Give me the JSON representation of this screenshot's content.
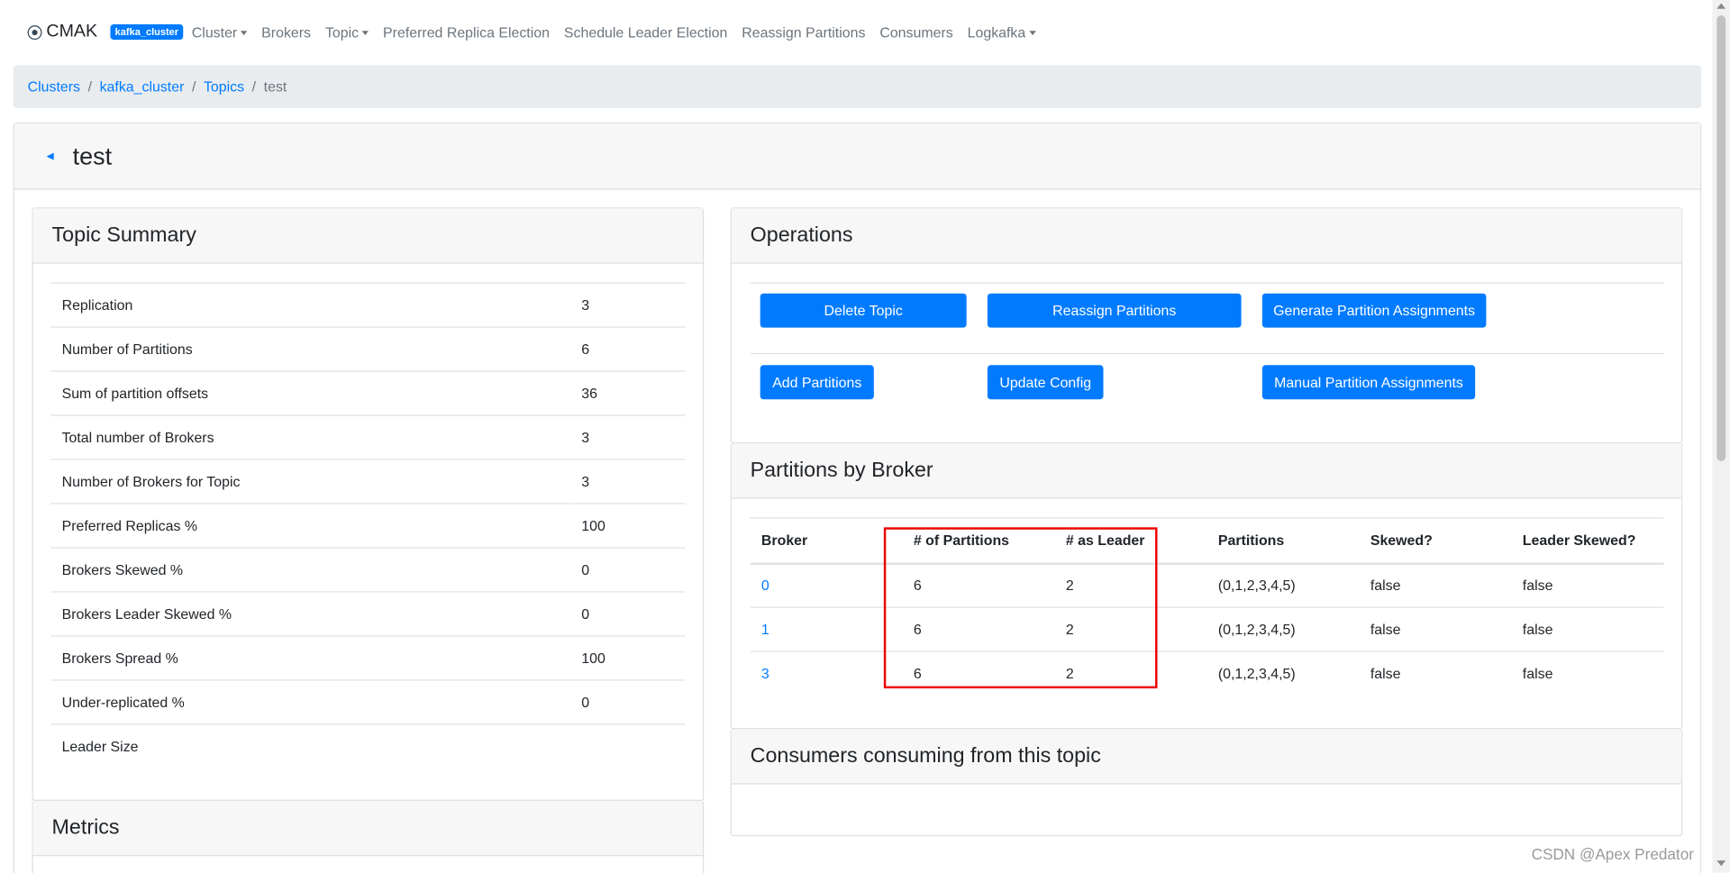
{
  "navbar": {
    "brand": "CMAK",
    "cluster_badge": "kafka_cluster",
    "items": [
      {
        "label": "Cluster",
        "dropdown": true
      },
      {
        "label": "Brokers",
        "dropdown": false
      },
      {
        "label": "Topic",
        "dropdown": true
      },
      {
        "label": "Preferred Replica Election",
        "dropdown": false
      },
      {
        "label": "Schedule Leader Election",
        "dropdown": false
      },
      {
        "label": "Reassign Partitions",
        "dropdown": false
      },
      {
        "label": "Consumers",
        "dropdown": false
      },
      {
        "label": "Logkafka",
        "dropdown": true
      }
    ]
  },
  "breadcrumb": {
    "items": [
      "Clusters",
      "kafka_cluster",
      "Topics"
    ],
    "active": "test"
  },
  "page": {
    "title": "test",
    "back_icon": "arrow-left-icon"
  },
  "summary": {
    "title": "Topic Summary",
    "rows": [
      {
        "label": "Replication",
        "value": "3"
      },
      {
        "label": "Number of Partitions",
        "value": "6"
      },
      {
        "label": "Sum of partition offsets",
        "value": "36"
      },
      {
        "label": "Total number of Brokers",
        "value": "3"
      },
      {
        "label": "Number of Brokers for Topic",
        "value": "3"
      },
      {
        "label": "Preferred Replicas %",
        "value": "100"
      },
      {
        "label": "Brokers Skewed %",
        "value": "0"
      },
      {
        "label": "Brokers Leader Skewed %",
        "value": "0"
      },
      {
        "label": "Brokers Spread %",
        "value": "100"
      },
      {
        "label": "Under-replicated %",
        "value": "0"
      },
      {
        "label": "Leader Size",
        "value": ""
      }
    ]
  },
  "metrics": {
    "title": "Metrics"
  },
  "operations": {
    "title": "Operations",
    "buttons": {
      "delete_topic": "Delete Topic",
      "reassign_partitions": "Reassign Partitions",
      "generate_assignments": "Generate Partition Assignments",
      "add_partitions": "Add Partitions",
      "update_config": "Update Config",
      "manual_assignments": "Manual Partition Assignments"
    }
  },
  "partitions_by_broker": {
    "title": "Partitions by Broker",
    "columns": [
      "Broker",
      "# of Partitions",
      "# as Leader",
      "Partitions",
      "Skewed?",
      "Leader Skewed?"
    ],
    "rows": [
      {
        "broker": "0",
        "partitions": "6",
        "as_leader": "2",
        "partition_list": "(0,1,2,3,4,5)",
        "skewed": "false",
        "leader_skewed": "false"
      },
      {
        "broker": "1",
        "partitions": "6",
        "as_leader": "2",
        "partition_list": "(0,1,2,3,4,5)",
        "skewed": "false",
        "leader_skewed": "false"
      },
      {
        "broker": "3",
        "partitions": "6",
        "as_leader": "2",
        "partition_list": "(0,1,2,3,4,5)",
        "skewed": "false",
        "leader_skewed": "false"
      }
    ]
  },
  "consumers": {
    "title": "Consumers consuming from this topic"
  },
  "watermark": "CSDN @Apex   Predator",
  "colors": {
    "accent": "#007bff",
    "highlight": "#e00000",
    "header_bg": "#f7f7f7",
    "breadcrumb_bg": "#e9ecef"
  }
}
